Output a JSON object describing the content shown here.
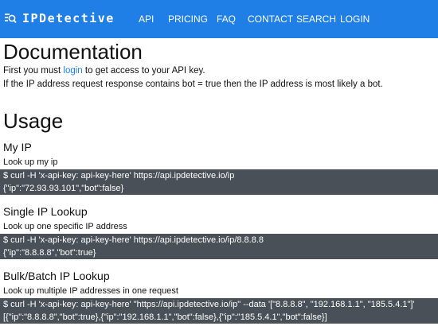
{
  "nav": {
    "brand": "IPDetective",
    "brand_icon": "search-list-icon",
    "items": [
      {
        "label": "API"
      },
      {
        "label": "PRICING"
      },
      {
        "label": "FAQ"
      },
      {
        "label": "CONTACT"
      },
      {
        "label": "SEARCH"
      },
      {
        "label": "LOGIN"
      }
    ]
  },
  "doc": {
    "title": "Documentation",
    "intro_prefix": "First you must ",
    "intro_link": "login",
    "intro_suffix": " to get access to your API key.",
    "intro_line2": "If the IP address request response contains bot = true then the IP address is most likely a bot."
  },
  "usage": {
    "title": "Usage",
    "sections": [
      {
        "title": "My IP",
        "desc": "Look up my ip",
        "command": "$ curl -H 'x-api-key: api-key-here' https://api.ipdetective.io/ip",
        "response": "{\"ip\":\"72.93.93.101\",\"bot\":false}"
      },
      {
        "title": "Single IP Lookup",
        "desc": "Look up one specific IP address",
        "command": "$ curl -H 'x-api-key: api-key-here' https://api.ipdetective.io/ip/8.8.8.8",
        "response": "{\"ip\":\"8.8.8.8\",\"bot\":true}"
      },
      {
        "title": "Bulk/Batch IP Lookup",
        "desc": "Look up multiple IP addresses in one request",
        "command": "$ curl -H 'x-api-key: api-key-here' \"https://api.ipdetective.io/ip\" --data '[\"8.8.8.8\", \"192.168.1.1\", \"185.5.4.1\"]'",
        "response": "[{\"ip\":\"8.8.8.8\",\"bot\":true},{\"ip\":\"192.168.1.1\",\"bot\":false},{\"ip\":\"185.5.4.1\",\"bot\":false}]"
      }
    ]
  },
  "colors": {
    "nav_background": "#1f7fe6",
    "code_background": "#4a5058",
    "link": "#1f7fe6"
  }
}
